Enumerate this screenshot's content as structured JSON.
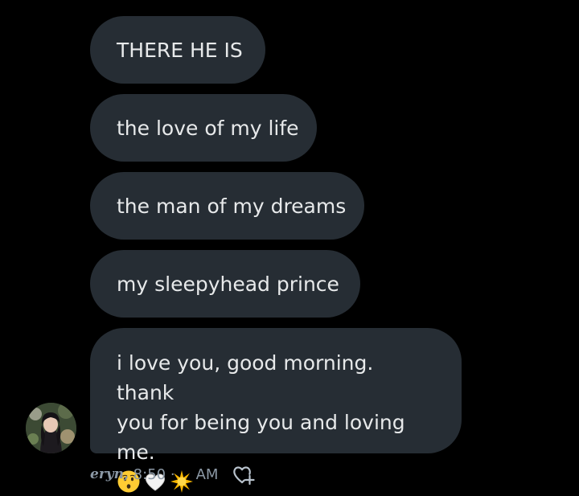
{
  "messages": [
    {
      "text": "THERE HE IS"
    },
    {
      "text": "the love of my life"
    },
    {
      "text": "the man of my dreams"
    },
    {
      "text": "my sleepyhead prince"
    },
    {
      "line1": "i love you, good morning. thank",
      "line2": "you for being you and loving me.",
      "emojis": [
        "kissing-face-emoji",
        "white-heart-emoji",
        "sparkle-sun-emoji"
      ]
    }
  ],
  "meta": {
    "sender": "eryn,",
    "time": "8:50",
    "dot": "·",
    "ampm": "AM"
  },
  "colors": {
    "background": "#000000",
    "bubble": "#262d34",
    "text": "#e7e9ea",
    "meta": "#8b98a5"
  }
}
